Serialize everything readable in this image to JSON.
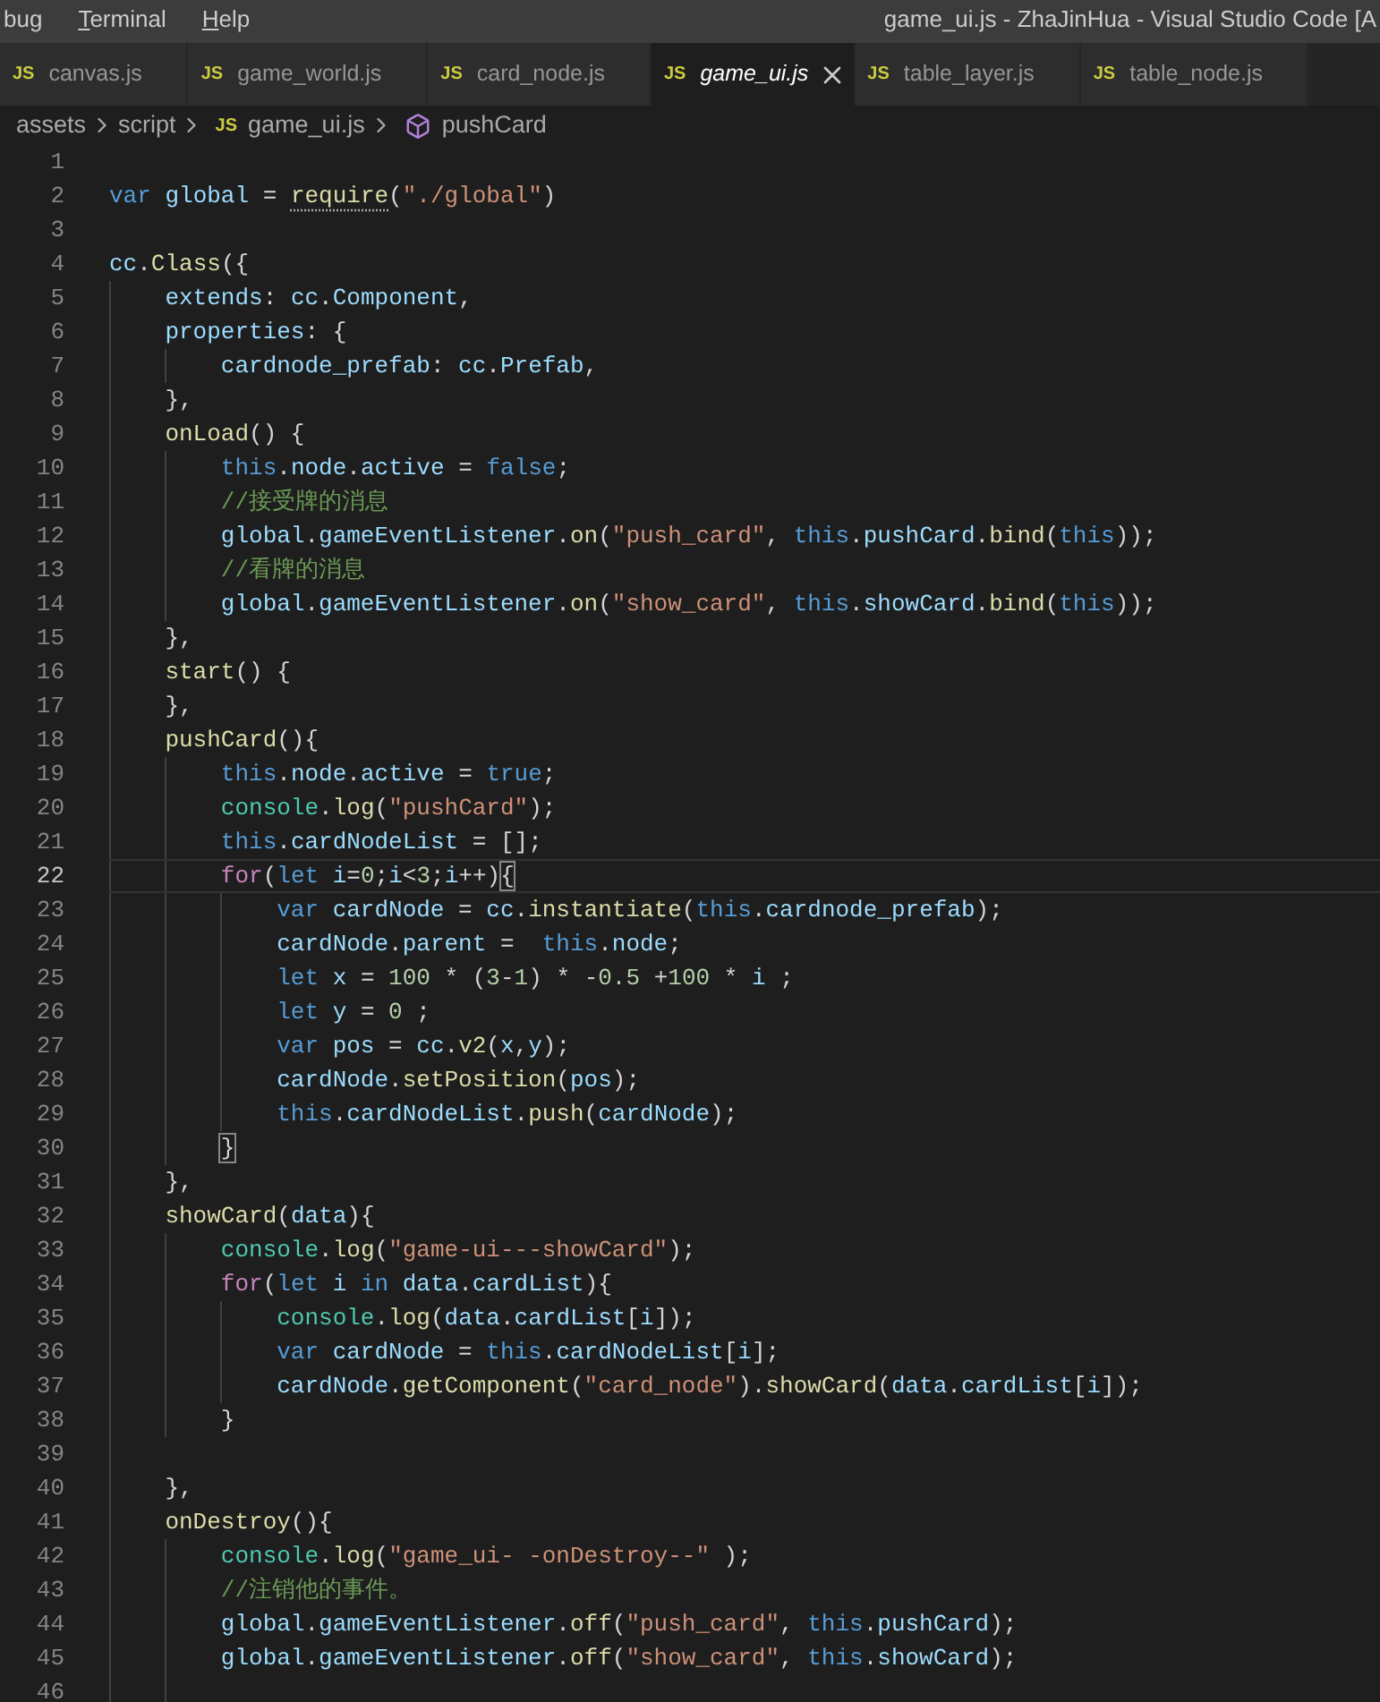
{
  "menu": [
    {
      "label": "bug",
      "mnemonic": false
    },
    {
      "label": "Terminal",
      "mnemonic": true
    },
    {
      "label": "Help",
      "mnemonic": true
    }
  ],
  "window": {
    "title": "game_ui.js - ZhaJinHua - Visual Studio Code [A"
  },
  "tabs": [
    {
      "icon": "JS",
      "label": "canvas.js",
      "selected": false
    },
    {
      "icon": "JS",
      "label": "game_world.js",
      "selected": false
    },
    {
      "icon": "JS",
      "label": "card_node.js",
      "selected": false
    },
    {
      "icon": "JS",
      "label": "game_ui.js",
      "selected": true
    },
    {
      "icon": "JS",
      "label": "table_layer.js",
      "selected": false
    },
    {
      "icon": "JS",
      "label": "table_node.js",
      "selected": false
    }
  ],
  "breadcrumb": [
    {
      "kind": "folder",
      "label": "assets"
    },
    {
      "kind": "folder",
      "label": "script"
    },
    {
      "kind": "file",
      "icon": "JS",
      "label": "game_ui.js"
    },
    {
      "kind": "symbol",
      "label": "pushCard"
    }
  ],
  "lines": [
    {
      "number": "1",
      "current": false
    },
    {
      "number": "2",
      "current": false,
      "tokens": [
        {
          "kind": "keyword",
          "text": "var "
        },
        {
          "kind": "variable",
          "text": "global"
        },
        {
          "kind": "plain",
          "text": " = "
        },
        {
          "kind": "hint",
          "text": "require"
        },
        {
          "kind": "plain",
          "text": "("
        },
        {
          "kind": "string",
          "text": "\"./global\""
        },
        {
          "kind": "plain",
          "text": ")"
        }
      ]
    },
    {
      "number": "3",
      "current": false
    },
    {
      "number": "4",
      "current": false,
      "tokens": [
        {
          "kind": "variable",
          "text": "cc"
        },
        {
          "kind": "plain",
          "text": "."
        },
        {
          "kind": "function",
          "text": "Class"
        },
        {
          "kind": "plain",
          "text": "({"
        }
      ]
    },
    {
      "number": "5",
      "current": false,
      "tokens": [
        {
          "kind": "variable",
          "text": "    extends"
        },
        {
          "kind": "plain",
          "text": ": "
        },
        {
          "kind": "variable",
          "text": "cc"
        },
        {
          "kind": "plain",
          "text": "."
        },
        {
          "kind": "variable",
          "text": "Component"
        },
        {
          "kind": "plain",
          "text": ","
        }
      ]
    },
    {
      "number": "6",
      "current": false,
      "tokens": [
        {
          "kind": "variable",
          "text": "    properties"
        },
        {
          "kind": "plain",
          "text": ": {"
        }
      ]
    },
    {
      "number": "7",
      "current": false,
      "tokens": [
        {
          "kind": "variable",
          "text": "        cardnode_prefab"
        },
        {
          "kind": "plain",
          "text": ": "
        },
        {
          "kind": "variable",
          "text": "cc"
        },
        {
          "kind": "plain",
          "text": "."
        },
        {
          "kind": "variable",
          "text": "Prefab"
        },
        {
          "kind": "plain",
          "text": ","
        }
      ]
    },
    {
      "number": "8",
      "current": false,
      "tokens": [
        {
          "kind": "plain",
          "text": "    },"
        }
      ]
    },
    {
      "number": "9",
      "current": false,
      "tokens": [
        {
          "kind": "function",
          "text": "    onLoad"
        },
        {
          "kind": "plain",
          "text": "() {"
        }
      ]
    },
    {
      "number": "10",
      "current": false,
      "tokens": [
        {
          "kind": "keyword",
          "text": "        this"
        },
        {
          "kind": "plain",
          "text": "."
        },
        {
          "kind": "variable",
          "text": "node"
        },
        {
          "kind": "plain",
          "text": "."
        },
        {
          "kind": "variable",
          "text": "active"
        },
        {
          "kind": "plain",
          "text": " = "
        },
        {
          "kind": "keyword",
          "text": "false"
        },
        {
          "kind": "plain",
          "text": ";"
        }
      ]
    },
    {
      "number": "11",
      "current": false,
      "tokens": [
        {
          "kind": "comment",
          "text": "        //接受牌的消息"
        }
      ]
    },
    {
      "number": "12",
      "current": false,
      "tokens": [
        {
          "kind": "variable",
          "text": "        global"
        },
        {
          "kind": "plain",
          "text": "."
        },
        {
          "kind": "variable",
          "text": "gameEventListener"
        },
        {
          "kind": "plain",
          "text": "."
        },
        {
          "kind": "function",
          "text": "on"
        },
        {
          "kind": "plain",
          "text": "("
        },
        {
          "kind": "string",
          "text": "\"push_card\""
        },
        {
          "kind": "plain",
          "text": ", "
        },
        {
          "kind": "keyword",
          "text": "this"
        },
        {
          "kind": "plain",
          "text": "."
        },
        {
          "kind": "variable",
          "text": "pushCard"
        },
        {
          "kind": "plain",
          "text": "."
        },
        {
          "kind": "function",
          "text": "bind"
        },
        {
          "kind": "plain",
          "text": "("
        },
        {
          "kind": "keyword",
          "text": "this"
        },
        {
          "kind": "plain",
          "text": "));"
        }
      ]
    },
    {
      "number": "13",
      "current": false,
      "tokens": [
        {
          "kind": "comment",
          "text": "        //看牌的消息"
        }
      ]
    },
    {
      "number": "14",
      "current": false,
      "tokens": [
        {
          "kind": "variable",
          "text": "        global"
        },
        {
          "kind": "plain",
          "text": "."
        },
        {
          "kind": "variable",
          "text": "gameEventListener"
        },
        {
          "kind": "plain",
          "text": "."
        },
        {
          "kind": "function",
          "text": "on"
        },
        {
          "kind": "plain",
          "text": "("
        },
        {
          "kind": "string",
          "text": "\"show_card\""
        },
        {
          "kind": "plain",
          "text": ", "
        },
        {
          "kind": "keyword",
          "text": "this"
        },
        {
          "kind": "plain",
          "text": "."
        },
        {
          "kind": "variable",
          "text": "showCard"
        },
        {
          "kind": "plain",
          "text": "."
        },
        {
          "kind": "function",
          "text": "bind"
        },
        {
          "kind": "plain",
          "text": "("
        },
        {
          "kind": "keyword",
          "text": "this"
        },
        {
          "kind": "plain",
          "text": "));"
        }
      ]
    },
    {
      "number": "15",
      "current": false,
      "tokens": [
        {
          "kind": "plain",
          "text": "    },"
        }
      ]
    },
    {
      "number": "16",
      "current": false,
      "tokens": [
        {
          "kind": "function",
          "text": "    start"
        },
        {
          "kind": "plain",
          "text": "() {"
        }
      ]
    },
    {
      "number": "17",
      "current": false,
      "tokens": [
        {
          "kind": "plain",
          "text": "    },"
        }
      ]
    },
    {
      "number": "18",
      "current": false,
      "tokens": [
        {
          "kind": "function",
          "text": "    pushCard"
        },
        {
          "kind": "plain",
          "text": "(){"
        }
      ]
    },
    {
      "number": "19",
      "current": false,
      "tokens": [
        {
          "kind": "keyword",
          "text": "        this"
        },
        {
          "kind": "plain",
          "text": "."
        },
        {
          "kind": "variable",
          "text": "node"
        },
        {
          "kind": "plain",
          "text": "."
        },
        {
          "kind": "variable",
          "text": "active"
        },
        {
          "kind": "plain",
          "text": " = "
        },
        {
          "kind": "keyword",
          "text": "true"
        },
        {
          "kind": "plain",
          "text": ";"
        }
      ]
    },
    {
      "number": "20",
      "current": false,
      "tokens": [
        {
          "kind": "type",
          "text": "        console"
        },
        {
          "kind": "plain",
          "text": "."
        },
        {
          "kind": "function",
          "text": "log"
        },
        {
          "kind": "plain",
          "text": "("
        },
        {
          "kind": "string",
          "text": "\"pushCard\""
        },
        {
          "kind": "plain",
          "text": ");"
        }
      ]
    },
    {
      "number": "21",
      "current": false,
      "tokens": [
        {
          "kind": "keyword",
          "text": "        this"
        },
        {
          "kind": "plain",
          "text": "."
        },
        {
          "kind": "variable",
          "text": "cardNodeList"
        },
        {
          "kind": "plain",
          "text": " = [];"
        }
      ]
    },
    {
      "number": "22",
      "current": true,
      "tokens": [
        {
          "kind": "control",
          "text": "        for"
        },
        {
          "kind": "plain",
          "text": "("
        },
        {
          "kind": "keyword",
          "text": "let "
        },
        {
          "kind": "variable",
          "text": "i"
        },
        {
          "kind": "plain",
          "text": "="
        },
        {
          "kind": "number",
          "text": "0"
        },
        {
          "kind": "plain",
          "text": ";"
        },
        {
          "kind": "variable",
          "text": "i"
        },
        {
          "kind": "plain",
          "text": "<"
        },
        {
          "kind": "number",
          "text": "3"
        },
        {
          "kind": "plain",
          "text": ";"
        },
        {
          "kind": "variable",
          "text": "i"
        },
        {
          "kind": "plain",
          "text": "++)"
        },
        {
          "kind": "match",
          "text": "{"
        }
      ]
    },
    {
      "number": "23",
      "current": false,
      "tokens": [
        {
          "kind": "keyword",
          "text": "            var "
        },
        {
          "kind": "variable",
          "text": "cardNode"
        },
        {
          "kind": "plain",
          "text": " = "
        },
        {
          "kind": "variable",
          "text": "cc"
        },
        {
          "kind": "plain",
          "text": "."
        },
        {
          "kind": "function",
          "text": "instantiate"
        },
        {
          "kind": "plain",
          "text": "("
        },
        {
          "kind": "keyword",
          "text": "this"
        },
        {
          "kind": "plain",
          "text": "."
        },
        {
          "kind": "variable",
          "text": "cardnode_prefab"
        },
        {
          "kind": "plain",
          "text": ");"
        }
      ]
    },
    {
      "number": "24",
      "current": false,
      "tokens": [
        {
          "kind": "variable",
          "text": "            cardNode"
        },
        {
          "kind": "plain",
          "text": "."
        },
        {
          "kind": "variable",
          "text": "parent"
        },
        {
          "kind": "plain",
          "text": " =  "
        },
        {
          "kind": "keyword",
          "text": "this"
        },
        {
          "kind": "plain",
          "text": "."
        },
        {
          "kind": "variable",
          "text": "node"
        },
        {
          "kind": "plain",
          "text": ";"
        }
      ]
    },
    {
      "number": "25",
      "current": false,
      "tokens": [
        {
          "kind": "keyword",
          "text": "            let "
        },
        {
          "kind": "variable",
          "text": "x"
        },
        {
          "kind": "plain",
          "text": " = "
        },
        {
          "kind": "number",
          "text": "100"
        },
        {
          "kind": "plain",
          "text": " * ("
        },
        {
          "kind": "number",
          "text": "3"
        },
        {
          "kind": "plain",
          "text": "-"
        },
        {
          "kind": "number",
          "text": "1"
        },
        {
          "kind": "plain",
          "text": ") * -"
        },
        {
          "kind": "number",
          "text": "0.5"
        },
        {
          "kind": "plain",
          "text": " +"
        },
        {
          "kind": "number",
          "text": "100"
        },
        {
          "kind": "plain",
          "text": " * "
        },
        {
          "kind": "variable",
          "text": "i"
        },
        {
          "kind": "plain",
          "text": " ;"
        }
      ]
    },
    {
      "number": "26",
      "current": false,
      "tokens": [
        {
          "kind": "keyword",
          "text": "            let "
        },
        {
          "kind": "variable",
          "text": "y"
        },
        {
          "kind": "plain",
          "text": " = "
        },
        {
          "kind": "number",
          "text": "0"
        },
        {
          "kind": "plain",
          "text": " ;"
        }
      ]
    },
    {
      "number": "27",
      "current": false,
      "tokens": [
        {
          "kind": "keyword",
          "text": "            var "
        },
        {
          "kind": "variable",
          "text": "pos"
        },
        {
          "kind": "plain",
          "text": " = "
        },
        {
          "kind": "variable",
          "text": "cc"
        },
        {
          "kind": "plain",
          "text": "."
        },
        {
          "kind": "function",
          "text": "v2"
        },
        {
          "kind": "plain",
          "text": "("
        },
        {
          "kind": "variable",
          "text": "x"
        },
        {
          "kind": "plain",
          "text": ","
        },
        {
          "kind": "variable",
          "text": "y"
        },
        {
          "kind": "plain",
          "text": ");"
        }
      ]
    },
    {
      "number": "28",
      "current": false,
      "tokens": [
        {
          "kind": "variable",
          "text": "            cardNode"
        },
        {
          "kind": "plain",
          "text": "."
        },
        {
          "kind": "function",
          "text": "setPosition"
        },
        {
          "kind": "plain",
          "text": "("
        },
        {
          "kind": "variable",
          "text": "pos"
        },
        {
          "kind": "plain",
          "text": ");"
        }
      ]
    },
    {
      "number": "29",
      "current": false,
      "tokens": [
        {
          "kind": "keyword",
          "text": "            this"
        },
        {
          "kind": "plain",
          "text": "."
        },
        {
          "kind": "variable",
          "text": "cardNodeList"
        },
        {
          "kind": "plain",
          "text": "."
        },
        {
          "kind": "function",
          "text": "push"
        },
        {
          "kind": "plain",
          "text": "("
        },
        {
          "kind": "variable",
          "text": "cardNode"
        },
        {
          "kind": "plain",
          "text": ");"
        }
      ]
    },
    {
      "number": "30",
      "current": false,
      "tokens": [
        {
          "kind": "match",
          "text": "        }"
        }
      ]
    },
    {
      "number": "31",
      "current": false,
      "tokens": [
        {
          "kind": "plain",
          "text": "    },"
        }
      ]
    },
    {
      "number": "32",
      "current": false,
      "tokens": [
        {
          "kind": "function",
          "text": "    showCard"
        },
        {
          "kind": "plain",
          "text": "("
        },
        {
          "kind": "variable",
          "text": "data"
        },
        {
          "kind": "plain",
          "text": "){"
        }
      ]
    },
    {
      "number": "33",
      "current": false,
      "tokens": [
        {
          "kind": "type",
          "text": "        console"
        },
        {
          "kind": "plain",
          "text": "."
        },
        {
          "kind": "function",
          "text": "log"
        },
        {
          "kind": "plain",
          "text": "("
        },
        {
          "kind": "string",
          "text": "\"game-ui---showCard\""
        },
        {
          "kind": "plain",
          "text": ");"
        }
      ]
    },
    {
      "number": "34",
      "current": false,
      "tokens": [
        {
          "kind": "control",
          "text": "        for"
        },
        {
          "kind": "plain",
          "text": "("
        },
        {
          "kind": "keyword",
          "text": "let "
        },
        {
          "kind": "variable",
          "text": "i "
        },
        {
          "kind": "keyword",
          "text": "in "
        },
        {
          "kind": "variable",
          "text": "data"
        },
        {
          "kind": "plain",
          "text": "."
        },
        {
          "kind": "variable",
          "text": "cardList"
        },
        {
          "kind": "plain",
          "text": "){"
        }
      ]
    },
    {
      "number": "35",
      "current": false,
      "tokens": [
        {
          "kind": "type",
          "text": "            console"
        },
        {
          "kind": "plain",
          "text": "."
        },
        {
          "kind": "function",
          "text": "log"
        },
        {
          "kind": "plain",
          "text": "("
        },
        {
          "kind": "variable",
          "text": "data"
        },
        {
          "kind": "plain",
          "text": "."
        },
        {
          "kind": "variable",
          "text": "cardList"
        },
        {
          "kind": "plain",
          "text": "["
        },
        {
          "kind": "variable",
          "text": "i"
        },
        {
          "kind": "plain",
          "text": "]);"
        }
      ]
    },
    {
      "number": "36",
      "current": false,
      "tokens": [
        {
          "kind": "keyword",
          "text": "            var "
        },
        {
          "kind": "variable",
          "text": "cardNode"
        },
        {
          "kind": "plain",
          "text": " = "
        },
        {
          "kind": "keyword",
          "text": "this"
        },
        {
          "kind": "plain",
          "text": "."
        },
        {
          "kind": "variable",
          "text": "cardNodeList"
        },
        {
          "kind": "plain",
          "text": "["
        },
        {
          "kind": "variable",
          "text": "i"
        },
        {
          "kind": "plain",
          "text": "];"
        }
      ]
    },
    {
      "number": "37",
      "current": false,
      "tokens": [
        {
          "kind": "variable",
          "text": "            cardNode"
        },
        {
          "kind": "plain",
          "text": "."
        },
        {
          "kind": "function",
          "text": "getComponent"
        },
        {
          "kind": "plain",
          "text": "("
        },
        {
          "kind": "string",
          "text": "\"card_node\""
        },
        {
          "kind": "plain",
          "text": ")."
        },
        {
          "kind": "function",
          "text": "showCard"
        },
        {
          "kind": "plain",
          "text": "("
        },
        {
          "kind": "variable",
          "text": "data"
        },
        {
          "kind": "plain",
          "text": "."
        },
        {
          "kind": "variable",
          "text": "cardList"
        },
        {
          "kind": "plain",
          "text": "["
        },
        {
          "kind": "variable",
          "text": "i"
        },
        {
          "kind": "plain",
          "text": "]);"
        }
      ]
    },
    {
      "number": "38",
      "current": false,
      "tokens": [
        {
          "kind": "plain",
          "text": "        }"
        }
      ]
    },
    {
      "number": "39",
      "current": false
    },
    {
      "number": "40",
      "current": false,
      "tokens": [
        {
          "kind": "plain",
          "text": "    },"
        }
      ]
    },
    {
      "number": "41",
      "current": false,
      "tokens": [
        {
          "kind": "function",
          "text": "    onDestroy"
        },
        {
          "kind": "plain",
          "text": "(){"
        }
      ]
    },
    {
      "number": "42",
      "current": false,
      "tokens": [
        {
          "kind": "type",
          "text": "        console"
        },
        {
          "kind": "plain",
          "text": "."
        },
        {
          "kind": "function",
          "text": "log"
        },
        {
          "kind": "plain",
          "text": "("
        },
        {
          "kind": "string",
          "text": "\"game_ui- -onDestroy--\""
        },
        {
          "kind": "plain",
          "text": " );"
        }
      ]
    },
    {
      "number": "43",
      "current": false,
      "tokens": [
        {
          "kind": "comment",
          "text": "        //注销他的事件。"
        }
      ]
    },
    {
      "number": "44",
      "current": false,
      "tokens": [
        {
          "kind": "variable",
          "text": "        global"
        },
        {
          "kind": "plain",
          "text": "."
        },
        {
          "kind": "variable",
          "text": "gameEventListener"
        },
        {
          "kind": "plain",
          "text": "."
        },
        {
          "kind": "function",
          "text": "off"
        },
        {
          "kind": "plain",
          "text": "("
        },
        {
          "kind": "string",
          "text": "\"push_card\""
        },
        {
          "kind": "plain",
          "text": ", "
        },
        {
          "kind": "keyword",
          "text": "this"
        },
        {
          "kind": "plain",
          "text": "."
        },
        {
          "kind": "variable",
          "text": "pushCard"
        },
        {
          "kind": "plain",
          "text": ");"
        }
      ]
    },
    {
      "number": "45",
      "current": false,
      "tokens": [
        {
          "kind": "variable",
          "text": "        global"
        },
        {
          "kind": "plain",
          "text": "."
        },
        {
          "kind": "variable",
          "text": "gameEventListener"
        },
        {
          "kind": "plain",
          "text": "."
        },
        {
          "kind": "function",
          "text": "off"
        },
        {
          "kind": "plain",
          "text": "("
        },
        {
          "kind": "string",
          "text": "\"show_card\""
        },
        {
          "kind": "plain",
          "text": ", "
        },
        {
          "kind": "keyword",
          "text": "this"
        },
        {
          "kind": "plain",
          "text": "."
        },
        {
          "kind": "variable",
          "text": "showCard"
        },
        {
          "kind": "plain",
          "text": ");"
        }
      ]
    },
    {
      "number": "46",
      "current": false
    }
  ]
}
